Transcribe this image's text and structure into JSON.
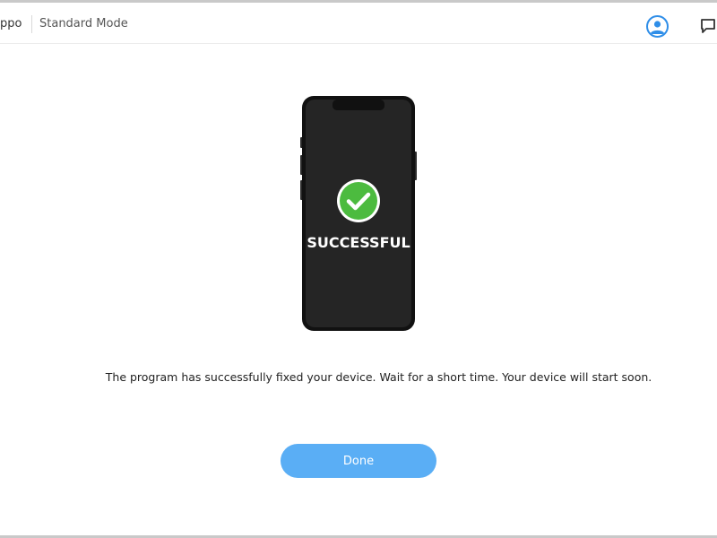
{
  "header": {
    "brand_label": "ppo",
    "mode_label": "Standard Mode",
    "avatar_icon": "user-avatar-icon",
    "feedback_icon": "chat-feedback-icon"
  },
  "phone": {
    "status_text": "SUCCESSFUL",
    "status_icon": "check-circle-icon"
  },
  "message": "The program has successfully fixed your device. Wait for a short time. Your device will start soon.",
  "actions": {
    "done_label": "Done"
  },
  "colors": {
    "accent": "#5aaef5",
    "success": "#4cbb3f",
    "phone_body": "#1f1f1f"
  }
}
